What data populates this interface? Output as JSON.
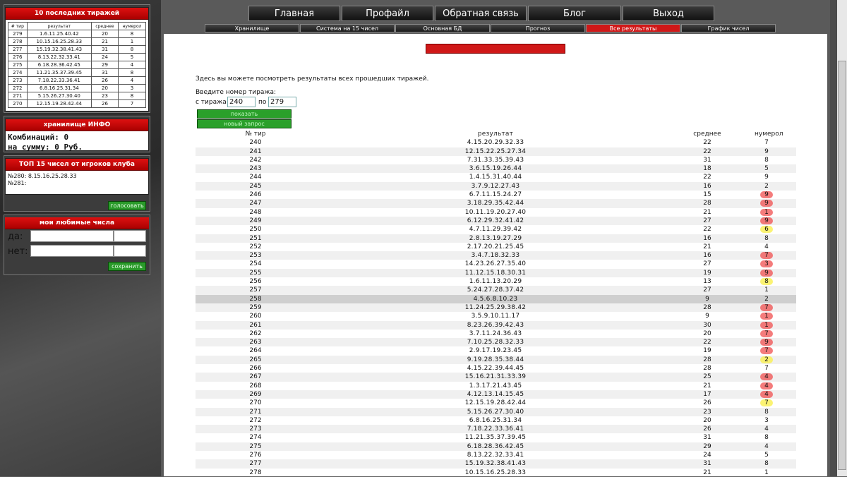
{
  "sidebar": {
    "last_draws": {
      "title": "10 последних тиражей",
      "headers": [
        "# тир",
        "результат",
        "среднее",
        "нумерол"
      ],
      "rows": [
        [
          "279",
          "1.6.11.25.40.42",
          "20",
          "8"
        ],
        [
          "278",
          "10.15.16.25.28.33",
          "21",
          "1"
        ],
        [
          "277",
          "15.19.32.38.41.43",
          "31",
          "8"
        ],
        [
          "276",
          "8.13.22.32.33.41",
          "24",
          "5"
        ],
        [
          "275",
          "6.18.28.36.42.45",
          "29",
          "4"
        ],
        [
          "274",
          "11.21.35.37.39.45",
          "31",
          "8"
        ],
        [
          "273",
          "7.18.22.33.36.41",
          "26",
          "4"
        ],
        [
          "272",
          "6.8.16.25.31.34",
          "20",
          "3"
        ],
        [
          "271",
          "5.15.26.27.30.40",
          "23",
          "8"
        ],
        [
          "270",
          "12.15.19.28.42.44",
          "26",
          "7"
        ]
      ]
    },
    "storage": {
      "title": "хранилище ИНФО",
      "combinations": "Комбинаций: 0",
      "sum": "на сумму: 0 Руб."
    },
    "top15": {
      "title": "ТОП 15 чисел от игроков клуба",
      "line1": "№280: 8.15.16.25.28.33",
      "line2": "№281:",
      "vote_label": "голосовать"
    },
    "favorites": {
      "title": "мои любимые числа",
      "yes_label": "да:",
      "no_label": "нет:",
      "save_label": "сохранить"
    }
  },
  "nav": {
    "main": [
      "Главная",
      "Профайл",
      "Обратная связь",
      "Блог",
      "Выход"
    ],
    "sub": [
      "Хранилище",
      "Система на 15 чисел",
      "Основная БД",
      "Прогноз",
      "Все результаты",
      "График чисел"
    ],
    "active_sub": "Все результаты"
  },
  "content": {
    "intro": "Здесь вы можете посмотреть результаты всех прошедших тиражей.",
    "enter_label": "Введите номер тиража:",
    "from_label": "с тиража",
    "from_value": "240",
    "to_label": "по",
    "to_value": "279",
    "show_label": "показать",
    "new_query_label": "новый запрос"
  },
  "results": {
    "headers": [
      "№ тир",
      "результат",
      "среднее",
      "нумерол"
    ],
    "selected_row": "258",
    "rows": [
      [
        "240",
        "4.15.20.29.32.33",
        "22",
        "7",
        ""
      ],
      [
        "241",
        "12.15.22.25.27.34",
        "22",
        "9",
        ""
      ],
      [
        "242",
        "7.31.33.35.39.43",
        "31",
        "8",
        ""
      ],
      [
        "243",
        "3.6.15.19.26.44",
        "18",
        "5",
        ""
      ],
      [
        "244",
        "1.4.15.31.40.44",
        "22",
        "9",
        ""
      ],
      [
        "245",
        "3.7.9.12.27.43",
        "16",
        "2",
        ""
      ],
      [
        "246",
        "6.7.11.15.24.27",
        "15",
        "9",
        "red"
      ],
      [
        "247",
        "3.18.29.35.42.44",
        "28",
        "9",
        "red"
      ],
      [
        "248",
        "10.11.19.20.27.40",
        "21",
        "1",
        "red"
      ],
      [
        "249",
        "6.12.29.32.41.42",
        "27",
        "9",
        "red"
      ],
      [
        "250",
        "4.7.11.29.39.42",
        "22",
        "6",
        "yellow"
      ],
      [
        "251",
        "2.8.13.19.27.29",
        "16",
        "8",
        ""
      ],
      [
        "252",
        "2.17.20.21.25.45",
        "21",
        "4",
        ""
      ],
      [
        "253",
        "3.4.7.18.32.33",
        "16",
        "7",
        "red"
      ],
      [
        "254",
        "14.23.26.27.35.40",
        "27",
        "3",
        "red"
      ],
      [
        "255",
        "11.12.15.18.30.31",
        "19",
        "9",
        "red"
      ],
      [
        "256",
        "1.6.11.13.20.29",
        "13",
        "8",
        "yellow"
      ],
      [
        "257",
        "5.24.27.28.37.42",
        "27",
        "1",
        ""
      ],
      [
        "258",
        "4.5.6.8.10.23",
        "9",
        "2",
        ""
      ],
      [
        "259",
        "11.24.25.29.38.42",
        "28",
        "7",
        "red"
      ],
      [
        "260",
        "3.5.9.10.11.17",
        "9",
        "1",
        "red"
      ],
      [
        "261",
        "8.23.26.39.42.43",
        "30",
        "1",
        "red"
      ],
      [
        "262",
        "3.7.11.24.36.43",
        "20",
        "7",
        "red"
      ],
      [
        "263",
        "7.10.25.28.32.33",
        "22",
        "9",
        "red"
      ],
      [
        "264",
        "2.9.17.19.23.45",
        "19",
        "7",
        "red"
      ],
      [
        "265",
        "9.19.28.35.38.44",
        "28",
        "2",
        "yellow"
      ],
      [
        "266",
        "4.15.22.39.44.45",
        "28",
        "7",
        ""
      ],
      [
        "267",
        "15.16.21.31.33.39",
        "25",
        "4",
        "red"
      ],
      [
        "268",
        "1.3.17.21.43.45",
        "21",
        "4",
        "red"
      ],
      [
        "269",
        "4.12.13.14.15.45",
        "17",
        "4",
        "red"
      ],
      [
        "270",
        "12.15.19.28.42.44",
        "26",
        "7",
        "yellow"
      ],
      [
        "271",
        "5.15.26.27.30.40",
        "23",
        "8",
        ""
      ],
      [
        "272",
        "6.8.16.25.31.34",
        "20",
        "3",
        ""
      ],
      [
        "273",
        "7.18.22.33.36.41",
        "26",
        "4",
        ""
      ],
      [
        "274",
        "11.21.35.37.39.45",
        "31",
        "8",
        ""
      ],
      [
        "275",
        "6.18.28.36.42.45",
        "29",
        "4",
        ""
      ],
      [
        "276",
        "8.13.22.32.33.41",
        "24",
        "5",
        ""
      ],
      [
        "277",
        "15.19.32.38.41.43",
        "31",
        "8",
        ""
      ],
      [
        "278",
        "10.15.16.25.28.33",
        "21",
        "1",
        ""
      ]
    ]
  },
  "colors": {
    "accent_red": "#d01818",
    "button_green": "#2aa02a",
    "mark_red": "#f05050",
    "mark_yellow": "#faf050"
  }
}
